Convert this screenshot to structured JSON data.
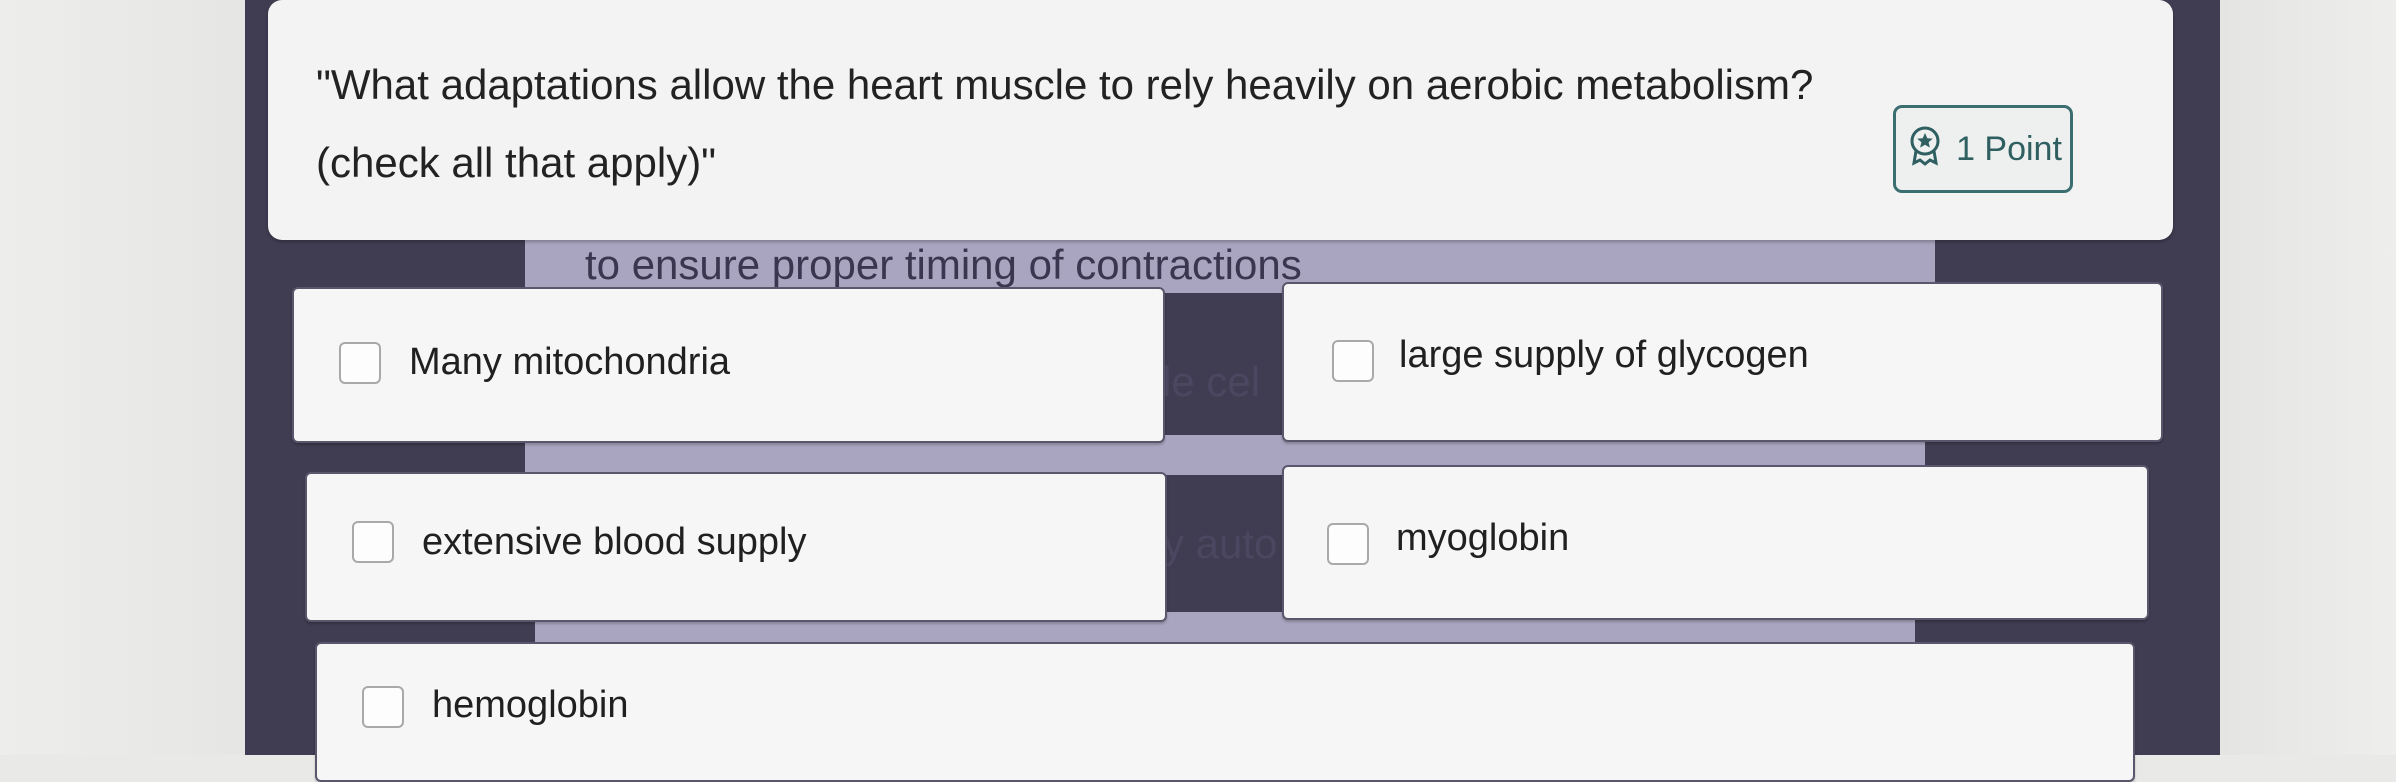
{
  "question": {
    "line1": "\"What adaptations allow the heart muscle to rely heavily on aerobic metabolism?",
    "line2": "(check all that apply)\"",
    "points_label": "1 Point",
    "badge_icon": "award-ribbon-icon"
  },
  "background_fragments": {
    "top_caption": "to ensure proper timing of contractions",
    "middle_peek_1": "le cel",
    "middle_peek_2": "y auto"
  },
  "answers": [
    {
      "label": "Many mitochondria",
      "checked": false
    },
    {
      "label": "large supply of glycogen",
      "checked": false
    },
    {
      "label": "extensive blood supply",
      "checked": false
    },
    {
      "label": "myoglobin",
      "checked": false
    },
    {
      "label": "hemoglobin",
      "checked": false
    }
  ],
  "colors": {
    "board": "#403c52",
    "card": "#f6f6f6",
    "badge_border": "#3b6e70"
  }
}
